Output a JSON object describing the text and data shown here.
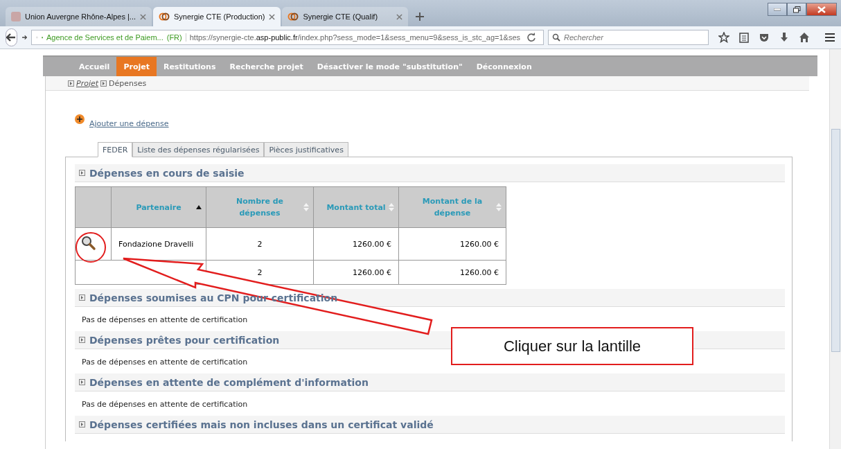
{
  "browser": {
    "tabs": [
      {
        "title": "Union Auvergne Rhône-Alpes |...",
        "selected": false,
        "kind": "blank"
      },
      {
        "title": "Synergie CTE (Production)",
        "selected": true,
        "kind": "site"
      },
      {
        "title": "Synergie CTE (Qualif)",
        "selected": false,
        "kind": "site"
      }
    ],
    "site_identity": "Agence de Services et de Paiem...",
    "site_country": "(FR)",
    "url": "https://synergie-cte.**asp-public.fr**/index.php?sess_mode=1&sess_menu=9&sess_is_stc_ag=1&ses",
    "search": {
      "placeholder": "Rechercher"
    }
  },
  "menu": [
    {
      "label": "Accueil",
      "selected": false
    },
    {
      "label": "Projet",
      "selected": true
    },
    {
      "label": "Restitutions",
      "selected": false
    },
    {
      "label": "Recherche projet",
      "selected": false
    },
    {
      "label": "Désactiver le mode \"substitution\"",
      "selected": false
    },
    {
      "label": "Déconnexion",
      "selected": false
    }
  ],
  "breadcrumb": [
    {
      "label": "Projet",
      "kind": "link"
    },
    {
      "label": "Dépenses",
      "kind": "current"
    }
  ],
  "add_link": "Ajouter une dépense",
  "content_tabs": [
    {
      "label": "FEDER",
      "selected": true
    },
    {
      "label": "Liste des dépenses régularisées",
      "selected": false
    },
    {
      "label": "Pièces justificatives",
      "selected": false
    }
  ],
  "sections": [
    {
      "title": "Dépenses en cours de saisie",
      "table": {
        "columns": [
          {
            "sortable": false
          },
          {
            "label": "Partenaire",
            "sortable": true,
            "sorted": true
          },
          {
            "label": "Nombre de dépenses",
            "sortable": true,
            "sorted": false
          },
          {
            "label": "Montant total",
            "sortable": true,
            "sorted": false
          },
          {
            "label": "Montant de la dépense",
            "sortable": true,
            "sorted": false
          }
        ],
        "rows": [
          {
            "kind": "item",
            "cells": [
              "",
              "Fondazione Dravelli",
              "2",
              "1260.00 €",
              "1260.00 €"
            ]
          },
          {
            "kind": "total",
            "cells": [
              "",
              "",
              "2",
              "1260.00 €",
              "1260.00 €"
            ]
          }
        ]
      }
    },
    {
      "title": "Dépenses soumises au CPN pour certification",
      "message": "Pas de dépenses en attente de certification"
    },
    {
      "title": "Dépenses prêtes pour certification",
      "message": "Pas de dépenses en attente de certification"
    },
    {
      "title": "Dépenses en attente de complément d'information",
      "message": "Pas de dépenses en attente de certification"
    },
    {
      "title": "Dépenses certifiées mais non incluses dans un certificat validé"
    }
  ],
  "annotation": {
    "callout": "Cliquer sur la lantille"
  }
}
